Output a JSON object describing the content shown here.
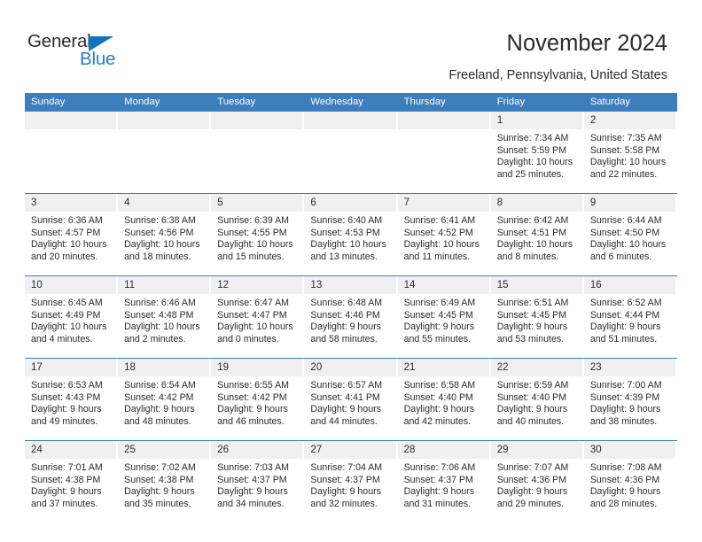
{
  "brand": {
    "name_part1": "General",
    "name_part2": "Blue",
    "triangle_color": "#1573be",
    "blue_color": "#1f7fc4"
  },
  "header": {
    "title": "November 2024",
    "location": "Freeland, Pennsylvania, United States",
    "header_bg": "#3d7ebc",
    "daynum_bg": "#f0f0f0"
  },
  "weekdays": [
    "Sunday",
    "Monday",
    "Tuesday",
    "Wednesday",
    "Thursday",
    "Friday",
    "Saturday"
  ],
  "weeks": [
    [
      {
        "day": "",
        "blank": true
      },
      {
        "day": "",
        "blank": true
      },
      {
        "day": "",
        "blank": true
      },
      {
        "day": "",
        "blank": true
      },
      {
        "day": "",
        "blank": true
      },
      {
        "day": "1",
        "sunrise": "Sunrise: 7:34 AM",
        "sunset": "Sunset: 5:59 PM",
        "daylight": "Daylight: 10 hours and 25 minutes."
      },
      {
        "day": "2",
        "sunrise": "Sunrise: 7:35 AM",
        "sunset": "Sunset: 5:58 PM",
        "daylight": "Daylight: 10 hours and 22 minutes."
      }
    ],
    [
      {
        "day": "3",
        "sunrise": "Sunrise: 6:36 AM",
        "sunset": "Sunset: 4:57 PM",
        "daylight": "Daylight: 10 hours and 20 minutes."
      },
      {
        "day": "4",
        "sunrise": "Sunrise: 6:38 AM",
        "sunset": "Sunset: 4:56 PM",
        "daylight": "Daylight: 10 hours and 18 minutes."
      },
      {
        "day": "5",
        "sunrise": "Sunrise: 6:39 AM",
        "sunset": "Sunset: 4:55 PM",
        "daylight": "Daylight: 10 hours and 15 minutes."
      },
      {
        "day": "6",
        "sunrise": "Sunrise: 6:40 AM",
        "sunset": "Sunset: 4:53 PM",
        "daylight": "Daylight: 10 hours and 13 minutes."
      },
      {
        "day": "7",
        "sunrise": "Sunrise: 6:41 AM",
        "sunset": "Sunset: 4:52 PM",
        "daylight": "Daylight: 10 hours and 11 minutes."
      },
      {
        "day": "8",
        "sunrise": "Sunrise: 6:42 AM",
        "sunset": "Sunset: 4:51 PM",
        "daylight": "Daylight: 10 hours and 8 minutes."
      },
      {
        "day": "9",
        "sunrise": "Sunrise: 6:44 AM",
        "sunset": "Sunset: 4:50 PM",
        "daylight": "Daylight: 10 hours and 6 minutes."
      }
    ],
    [
      {
        "day": "10",
        "sunrise": "Sunrise: 6:45 AM",
        "sunset": "Sunset: 4:49 PM",
        "daylight": "Daylight: 10 hours and 4 minutes."
      },
      {
        "day": "11",
        "sunrise": "Sunrise: 6:46 AM",
        "sunset": "Sunset: 4:48 PM",
        "daylight": "Daylight: 10 hours and 2 minutes."
      },
      {
        "day": "12",
        "sunrise": "Sunrise: 6:47 AM",
        "sunset": "Sunset: 4:47 PM",
        "daylight": "Daylight: 10 hours and 0 minutes."
      },
      {
        "day": "13",
        "sunrise": "Sunrise: 6:48 AM",
        "sunset": "Sunset: 4:46 PM",
        "daylight": "Daylight: 9 hours and 58 minutes."
      },
      {
        "day": "14",
        "sunrise": "Sunrise: 6:49 AM",
        "sunset": "Sunset: 4:45 PM",
        "daylight": "Daylight: 9 hours and 55 minutes."
      },
      {
        "day": "15",
        "sunrise": "Sunrise: 6:51 AM",
        "sunset": "Sunset: 4:45 PM",
        "daylight": "Daylight: 9 hours and 53 minutes."
      },
      {
        "day": "16",
        "sunrise": "Sunrise: 6:52 AM",
        "sunset": "Sunset: 4:44 PM",
        "daylight": "Daylight: 9 hours and 51 minutes."
      }
    ],
    [
      {
        "day": "17",
        "sunrise": "Sunrise: 6:53 AM",
        "sunset": "Sunset: 4:43 PM",
        "daylight": "Daylight: 9 hours and 49 minutes."
      },
      {
        "day": "18",
        "sunrise": "Sunrise: 6:54 AM",
        "sunset": "Sunset: 4:42 PM",
        "daylight": "Daylight: 9 hours and 48 minutes."
      },
      {
        "day": "19",
        "sunrise": "Sunrise: 6:55 AM",
        "sunset": "Sunset: 4:42 PM",
        "daylight": "Daylight: 9 hours and 46 minutes."
      },
      {
        "day": "20",
        "sunrise": "Sunrise: 6:57 AM",
        "sunset": "Sunset: 4:41 PM",
        "daylight": "Daylight: 9 hours and 44 minutes."
      },
      {
        "day": "21",
        "sunrise": "Sunrise: 6:58 AM",
        "sunset": "Sunset: 4:40 PM",
        "daylight": "Daylight: 9 hours and 42 minutes."
      },
      {
        "day": "22",
        "sunrise": "Sunrise: 6:59 AM",
        "sunset": "Sunset: 4:40 PM",
        "daylight": "Daylight: 9 hours and 40 minutes."
      },
      {
        "day": "23",
        "sunrise": "Sunrise: 7:00 AM",
        "sunset": "Sunset: 4:39 PM",
        "daylight": "Daylight: 9 hours and 38 minutes."
      }
    ],
    [
      {
        "day": "24",
        "sunrise": "Sunrise: 7:01 AM",
        "sunset": "Sunset: 4:38 PM",
        "daylight": "Daylight: 9 hours and 37 minutes."
      },
      {
        "day": "25",
        "sunrise": "Sunrise: 7:02 AM",
        "sunset": "Sunset: 4:38 PM",
        "daylight": "Daylight: 9 hours and 35 minutes."
      },
      {
        "day": "26",
        "sunrise": "Sunrise: 7:03 AM",
        "sunset": "Sunset: 4:37 PM",
        "daylight": "Daylight: 9 hours and 34 minutes."
      },
      {
        "day": "27",
        "sunrise": "Sunrise: 7:04 AM",
        "sunset": "Sunset: 4:37 PM",
        "daylight": "Daylight: 9 hours and 32 minutes."
      },
      {
        "day": "28",
        "sunrise": "Sunrise: 7:06 AM",
        "sunset": "Sunset: 4:37 PM",
        "daylight": "Daylight: 9 hours and 31 minutes."
      },
      {
        "day": "29",
        "sunrise": "Sunrise: 7:07 AM",
        "sunset": "Sunset: 4:36 PM",
        "daylight": "Daylight: 9 hours and 29 minutes."
      },
      {
        "day": "30",
        "sunrise": "Sunrise: 7:08 AM",
        "sunset": "Sunset: 4:36 PM",
        "daylight": "Daylight: 9 hours and 28 minutes."
      }
    ]
  ]
}
